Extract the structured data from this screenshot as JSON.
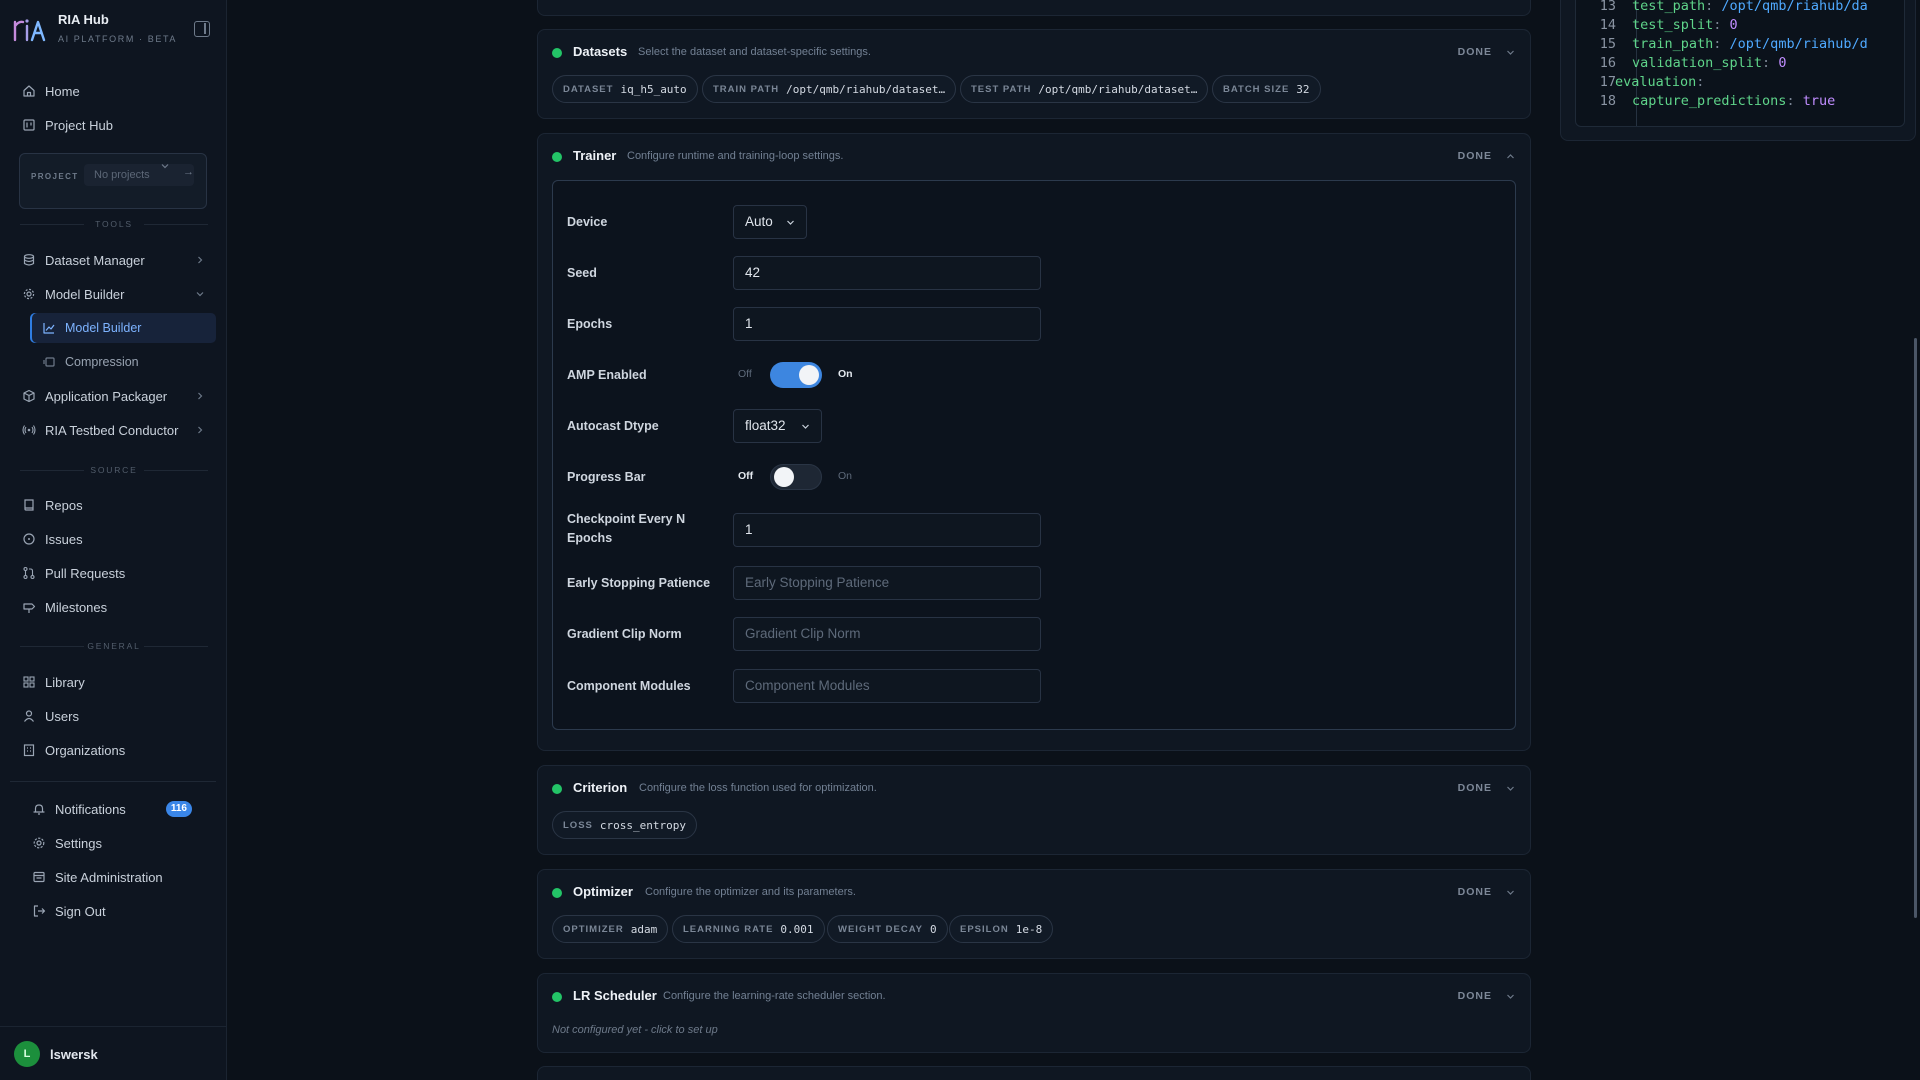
{
  "brand": {
    "title": "RIA Hub",
    "subtitle": "AI PLATFORM · BETA"
  },
  "nav": {
    "home": "Home",
    "project_hub": "Project Hub",
    "project_label": "PROJECT",
    "project_select": "No projects",
    "project_arrow": "→",
    "tools_label": "TOOLS",
    "dataset_manager": "Dataset Manager",
    "model_builder": "Model Builder",
    "model_builder_sub": "Model Builder",
    "compression": "Compression",
    "application_packager": "Application Packager",
    "testbed_conductor": "RIA Testbed Conductor",
    "source_label": "SOURCE",
    "repos": "Repos",
    "issues": "Issues",
    "pull_requests": "Pull Requests",
    "milestones": "Milestones",
    "general_label": "GENERAL",
    "library": "Library",
    "users": "Users",
    "organizations": "Organizations",
    "notifications": "Notifications",
    "notifications_count": "116",
    "settings": "Settings",
    "site_admin": "Site Administration",
    "sign_out": "Sign Out"
  },
  "user": {
    "initial": "L",
    "name": "lswersk"
  },
  "datasets": {
    "title": "Datasets",
    "desc": "Select the dataset and dataset-specific settings.",
    "status": "DONE",
    "chips": [
      {
        "k": "DATASET",
        "v": "iq_h5_auto"
      },
      {
        "k": "TRAIN PATH",
        "v": "/opt/qmb/riahub/dataset…"
      },
      {
        "k": "TEST PATH",
        "v": "/opt/qmb/riahub/dataset…"
      },
      {
        "k": "BATCH SIZE",
        "v": "32"
      }
    ]
  },
  "trainer": {
    "title": "Trainer",
    "desc": "Configure runtime and training-loop settings.",
    "status": "DONE",
    "device": {
      "label": "Device",
      "value": "Auto"
    },
    "seed": {
      "label": "Seed",
      "value": "42"
    },
    "epochs": {
      "label": "Epochs",
      "value": "1"
    },
    "amp": {
      "label": "AMP Enabled",
      "off": "Off",
      "on": "On",
      "enabled": true
    },
    "autocast": {
      "label": "Autocast Dtype",
      "value": "float32"
    },
    "progress": {
      "label": "Progress Bar",
      "off": "Off",
      "on": "On",
      "enabled": false
    },
    "checkpoint": {
      "label_line1": "Checkpoint Every N",
      "label_line2": "Epochs",
      "value": "1"
    },
    "early_stopping": {
      "label": "Early Stopping Patience",
      "placeholder": "Early Stopping Patience"
    },
    "grad_clip": {
      "label": "Gradient Clip Norm",
      "placeholder": "Gradient Clip Norm"
    },
    "component_modules": {
      "label": "Component Modules",
      "placeholder": "Component Modules"
    }
  },
  "criterion": {
    "title": "Criterion",
    "desc": "Configure the loss function used for optimization.",
    "status": "DONE",
    "chips": [
      {
        "k": "LOSS",
        "v": "cross_entropy"
      }
    ]
  },
  "optimizer": {
    "title": "Optimizer",
    "desc": "Configure the optimizer and its parameters.",
    "status": "DONE",
    "chips": [
      {
        "k": "OPTIMIZER",
        "v": "adam"
      },
      {
        "k": "LEARNING RATE",
        "v": "0.001"
      },
      {
        "k": "WEIGHT DECAY",
        "v": "0"
      },
      {
        "k": "EPSILON",
        "v": "1e-8"
      }
    ]
  },
  "scheduler": {
    "title": "LR Scheduler",
    "desc": "Configure the learning-rate scheduler section.",
    "status": "DONE",
    "note": "Not configured yet - click to set up"
  },
  "code": {
    "lines": [
      {
        "n": "13",
        "key": "test_path",
        "val": "/opt/qmb/riahub/da",
        "kind": "str"
      },
      {
        "n": "14",
        "key": "test_split",
        "val": "0",
        "kind": "num"
      },
      {
        "n": "15",
        "key": "train_path",
        "val": "/opt/qmb/riahub/d",
        "kind": "str"
      },
      {
        "n": "16",
        "key": "validation_split",
        "val": "0",
        "kind": "num"
      },
      {
        "n": "17",
        "key": "evaluation",
        "val": "",
        "kind": "section"
      },
      {
        "n": "18",
        "key": "capture_predictions",
        "val": "true",
        "kind": "bool"
      }
    ]
  },
  "colors": {
    "accent": "#3d86e0",
    "status_done": "#23c467",
    "badge": "#3a86e8",
    "code_key": "#5fd48a",
    "code_string": "#4fa9ff",
    "code_number": "#c08dff"
  }
}
